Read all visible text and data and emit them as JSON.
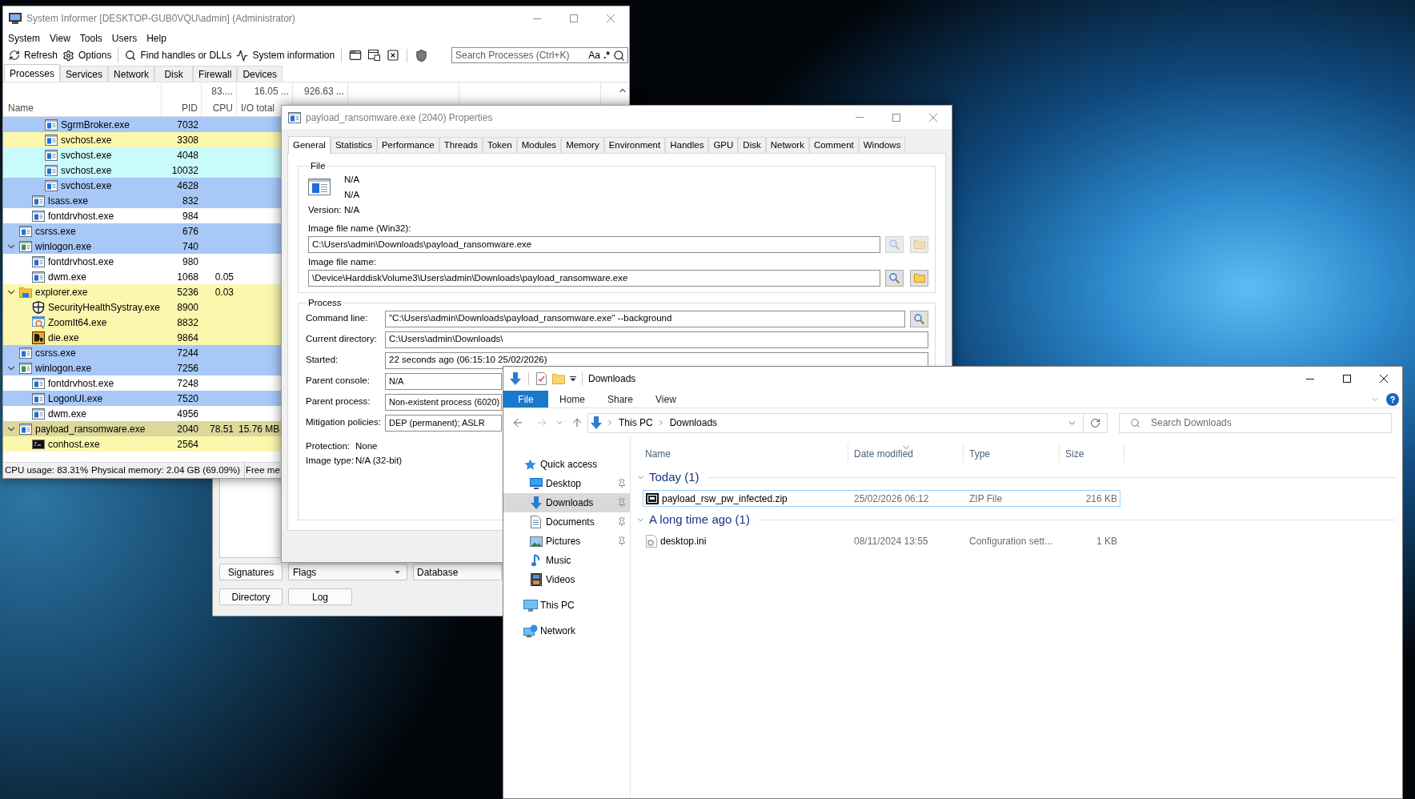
{
  "system_informer": {
    "window": {
      "title": "System Informer [DESKTOP-GUB0VQU\\admin] (Administrator)"
    },
    "menu": [
      "System",
      "View",
      "Tools",
      "Users",
      "Help"
    ],
    "toolbar": [
      [
        {
          "kind": "refresh",
          "label": "Refresh"
        },
        {
          "kind": "options",
          "label": "Options"
        }
      ],
      [
        {
          "kind": "find",
          "label": "Find handles or DLLs"
        },
        {
          "kind": "sysinfo",
          "label": "System information"
        }
      ],
      [
        {
          "kind": "window"
        },
        {
          "kind": "window-tool"
        },
        {
          "kind": "close-box"
        }
      ],
      [
        {
          "kind": "shield"
        }
      ]
    ],
    "search": {
      "placeholder": "Search Processes (Ctrl+K)",
      "case_toggle": "Aa",
      "regex_toggle": ".*"
    },
    "tabs": [
      {
        "label": "Processes",
        "selected": true
      },
      {
        "label": "Services",
        "selected": false
      },
      {
        "label": "Network",
        "selected": false
      },
      {
        "label": "Disk",
        "selected": false
      },
      {
        "label": "Firewall",
        "selected": false
      },
      {
        "label": "Devices",
        "selected": false
      }
    ],
    "columns": [
      {
        "label": "Name"
      },
      {
        "label": "PID"
      },
      {
        "label": "CPU",
        "total": "83...."
      },
      {
        "label": "I/O total",
        "total": "16.05 ..."
      },
      {
        "total": "926.63 ..."
      }
    ],
    "processes": [
      {
        "children": [
          {
            "children": [
              {
                "name": "SgrmBroker.exe",
                "pid": "7032",
                "kind": "app",
                "color": "#a8c8f8"
              },
              {
                "name": "svchost.exe",
                "pid": "3308",
                "kind": "app",
                "color": "#fbf7ad"
              },
              {
                "name": "svchost.exe",
                "pid": "4048",
                "kind": "app",
                "color": "#c9fbfb"
              },
              {
                "name": "svchost.exe",
                "pid": "10032",
                "kind": "app",
                "color": "#c9fbfb"
              },
              {
                "name": "svchost.exe",
                "pid": "4628",
                "kind": "app",
                "color": "#a8c8f8"
              }
            ]
          },
          {
            "name": "lsass.exe",
            "pid": "832",
            "kind": "app",
            "color": "#a8c8f8"
          },
          {
            "name": "fontdrvhost.exe",
            "pid": "984",
            "kind": "app",
            "color": "#ffffff"
          }
        ]
      },
      {
        "name": "csrss.exe",
        "pid": "676",
        "kind": "app",
        "color": "#a8c8f8"
      },
      {
        "name": "winlogon.exe",
        "pid": "740",
        "kind": "logon",
        "color": "#a8c8f8",
        "expanded": true,
        "children": [
          {
            "name": "fontdrvhost.exe",
            "pid": "980",
            "kind": "app",
            "color": "#ffffff"
          },
          {
            "name": "dwm.exe",
            "pid": "1068",
            "cpu": "0.05",
            "kind": "app",
            "color": "#ffffff"
          }
        ]
      },
      {
        "name": "explorer.exe",
        "pid": "5236",
        "cpu": "0.03",
        "kind": "folder",
        "color": "#fbf7ad",
        "expanded": true,
        "children": [
          {
            "name": "SecurityHealthSystray.exe",
            "pid": "8900",
            "kind": "shield",
            "color": "#fbf7ad"
          },
          {
            "name": "ZoomIt64.exe",
            "pid": "8832",
            "kind": "zoom",
            "color": "#fbf7ad"
          },
          {
            "name": "die.exe",
            "pid": "9864",
            "kind": "die",
            "color": "#fbf7ad"
          }
        ]
      },
      {
        "name": "csrss.exe",
        "pid": "7244",
        "kind": "app",
        "color": "#a8c8f8"
      },
      {
        "name": "winlogon.exe",
        "pid": "7256",
        "kind": "logon",
        "color": "#a8c8f8",
        "expanded": true,
        "children": [
          {
            "name": "fontdrvhost.exe",
            "pid": "7248",
            "kind": "app",
            "color": "#ffffff"
          },
          {
            "name": "LogonUI.exe",
            "pid": "7520",
            "kind": "app",
            "color": "#a8c8f8"
          },
          {
            "name": "dwm.exe",
            "pid": "4956",
            "kind": "app",
            "color": "#ffffff"
          }
        ]
      },
      {
        "name": "payload_ransomware.exe",
        "pid": "2040",
        "cpu": "78.51",
        "io": "15.76 MB",
        "kind": "app",
        "color": "#dcd89c",
        "expanded": true,
        "children": [
          {
            "name": "conhost.exe",
            "pid": "2564",
            "kind": "console",
            "color": "#fbf7ad"
          }
        ]
      }
    ],
    "status_bar": [
      "CPU usage: 83.31%",
      "Physical memory: 2.04 GB (69.09%)",
      "Free me"
    ]
  },
  "properties": {
    "window": {
      "title": "payload_ransomware.exe (2040) Properties"
    },
    "tabs": [
      {
        "label": "General",
        "selected": true
      },
      {
        "label": "Statistics",
        "selected": false
      },
      {
        "label": "Performance",
        "selected": false
      },
      {
        "label": "Threads",
        "selected": false
      },
      {
        "label": "Token",
        "selected": false
      },
      {
        "label": "Modules",
        "selected": false
      },
      {
        "label": "Memory",
        "selected": false
      },
      {
        "label": "Environment",
        "selected": false
      },
      {
        "label": "Handles",
        "selected": false
      },
      {
        "label": "GPU",
        "selected": false
      },
      {
        "label": "Disk",
        "selected": false
      },
      {
        "label": "Network",
        "selected": false
      },
      {
        "label": "Comment",
        "selected": false
      },
      {
        "label": "Windows",
        "selected": false
      }
    ],
    "file": {
      "title": "File",
      "lines": [
        "N/A",
        "N/A"
      ],
      "version": {
        "label": "Version:",
        "value": "N/A"
      },
      "fields": [
        {
          "label": "Image file name (Win32):",
          "value": "C:\\Users\\admin\\Downloads\\payload_ransomware.exe",
          "buttons": [
            {
              "kind": "search",
              "disabled": true
            },
            {
              "kind": "folder",
              "disabled": true
            }
          ]
        },
        {
          "label": "Image file name:",
          "value": "\\Device\\HarddiskVolume3\\Users\\admin\\Downloads\\payload_ransomware.exe",
          "buttons": [
            {
              "kind": "search",
              "disabled": false
            },
            {
              "kind": "folder",
              "disabled": false
            }
          ]
        }
      ]
    },
    "process": {
      "title": "Process",
      "fields": [
        {
          "label": "Command line:",
          "value": "\"C:\\Users\\admin\\Downloads\\payload_ransomware.exe\" --background",
          "buttons": [
            {
              "kind": "search",
              "disabled": false
            }
          ]
        },
        {
          "label": "Current directory:",
          "value": "C:\\Users\\admin\\Downloads\\"
        },
        {
          "label": "Started:",
          "value": "22 seconds ago (06:15:10 25/02/2026)"
        },
        {
          "label": "Parent console:",
          "value": "N/A"
        },
        {
          "label": "Parent process:",
          "value": "Non-existent process (6020)"
        },
        {
          "label": "Mitigation policies:",
          "value": "DEP (permanent); ASLR"
        }
      ],
      "info": [
        {
          "label": "Protection:",
          "value": "None"
        },
        {
          "label": "Image type:",
          "value": "N/A (32-bit)"
        }
      ]
    }
  },
  "dialog": {
    "button_rows": [
      [
        {
          "kind": "button",
          "label": "Signatures"
        },
        {
          "kind": "dropdown",
          "label": "Flags"
        },
        {
          "kind": "field",
          "label": "Database"
        }
      ],
      [
        {
          "kind": "button",
          "label": "Directory"
        },
        {
          "kind": "button",
          "label": "Log"
        }
      ]
    ]
  },
  "explorer": {
    "window": {
      "title": "Downloads"
    },
    "file_tab": "File",
    "ribbon_tabs": [
      "Home",
      "Share",
      "View"
    ],
    "breadcrumb": [
      "This PC",
      "Downloads"
    ],
    "search": {
      "placeholder": "Search Downloads"
    },
    "nav": [
      {
        "label": "Quick access",
        "kind": "star",
        "selected": false,
        "children": [
          {
            "label": "Desktop",
            "kind": "desktop",
            "pinned": true,
            "selected": false
          },
          {
            "label": "Downloads",
            "kind": "downloads",
            "pinned": true,
            "selected": true
          },
          {
            "label": "Documents",
            "kind": "documents",
            "pinned": true,
            "selected": false
          },
          {
            "label": "Pictures",
            "kind": "pictures",
            "pinned": true,
            "selected": false
          },
          {
            "label": "Music",
            "kind": "music",
            "pinned": false,
            "selected": false
          },
          {
            "label": "Videos",
            "kind": "videos",
            "pinned": false,
            "selected": false
          }
        ]
      },
      {
        "label": "This PC",
        "kind": "pc",
        "selected": false
      },
      {
        "label": "Network",
        "kind": "network",
        "selected": false
      }
    ],
    "columns": [
      {
        "label": "Name",
        "sorted": false
      },
      {
        "label": "Date modified",
        "sorted": true
      },
      {
        "label": "Type",
        "sorted": false
      },
      {
        "label": "Size",
        "sorted": false
      }
    ],
    "groups": [
      {
        "label": "Today (1)",
        "expanded": true,
        "files": [
          {
            "name": "payload_rsw_pw_infected.zip",
            "kind": "archive",
            "date": "25/02/2026 06:12",
            "type": "ZIP File",
            "size": "216 KB",
            "selected": true
          }
        ]
      },
      {
        "label": "A long time ago (1)",
        "expanded": true,
        "files": [
          {
            "name": "desktop.ini",
            "kind": "settings",
            "date": "08/11/2024 13:55",
            "type": "Configuration sett...",
            "size": "1 KB",
            "selected": false
          }
        ]
      }
    ]
  }
}
